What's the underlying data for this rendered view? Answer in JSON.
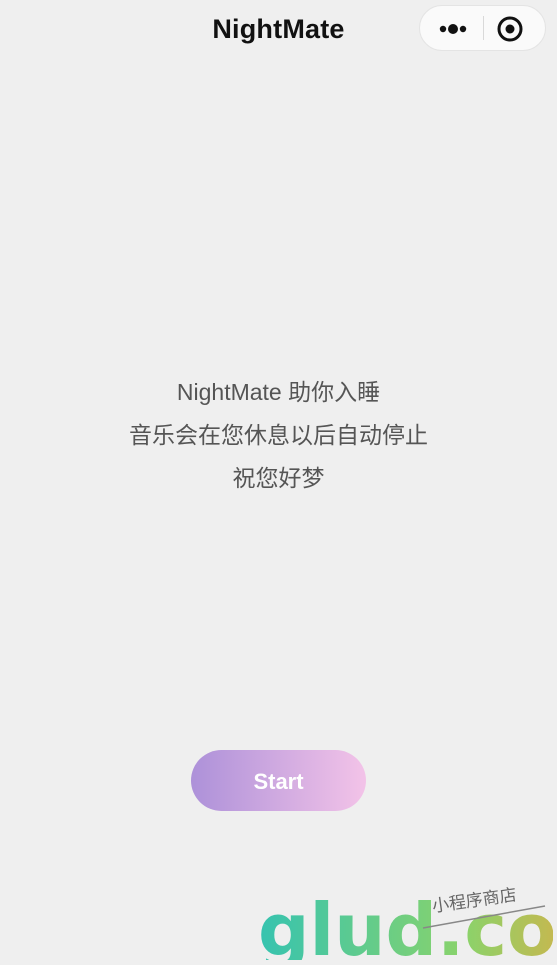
{
  "header": {
    "title": "NightMate"
  },
  "capsule": {
    "more_icon": "more-dots-icon",
    "close_icon": "target-close-icon"
  },
  "message": {
    "line1": "NightMate 助你入睡",
    "line2": "音乐会在您休息以后自动停止",
    "line3": "祝您好梦"
  },
  "start_button": {
    "label": "Start",
    "gradient_start": "#ad91d9",
    "gradient_end": "#f3c3e8"
  },
  "watermark": {
    "text": "glud.com",
    "sub": "小程序商店"
  }
}
